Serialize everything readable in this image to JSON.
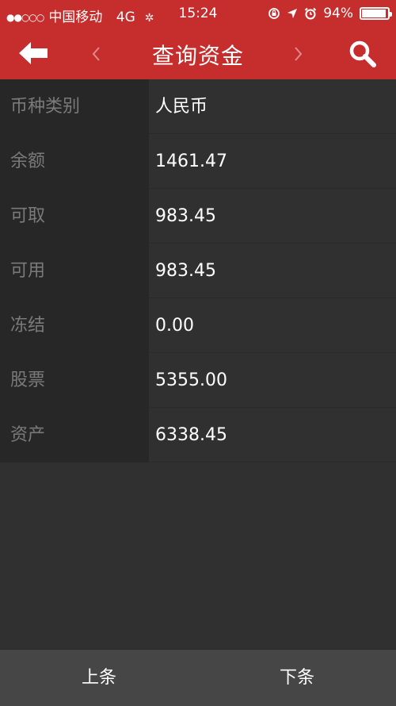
{
  "status_bar": {
    "signal": "●●○○○",
    "carrier": "中国移动",
    "network": "4G",
    "time": "15:24",
    "battery_percent": "94%",
    "battery_level": 0.94
  },
  "header": {
    "title": "查询资金",
    "icons": [
      "back-arrow-icon",
      "chevron-left-icon",
      "chevron-right-icon",
      "search-icon"
    ],
    "accent_color": "#c62d2d"
  },
  "rows": [
    {
      "label": "币种类别",
      "value": "人民币"
    },
    {
      "label": "余额",
      "value": "1461.47"
    },
    {
      "label": "可取",
      "value": "983.45"
    },
    {
      "label": "可用",
      "value": "983.45"
    },
    {
      "label": "冻结",
      "value": "0.00"
    },
    {
      "label": "股票",
      "value": "5355.00"
    },
    {
      "label": "资产",
      "value": "6338.45"
    }
  ],
  "footer": {
    "prev_label": "上条",
    "next_label": "下条"
  }
}
